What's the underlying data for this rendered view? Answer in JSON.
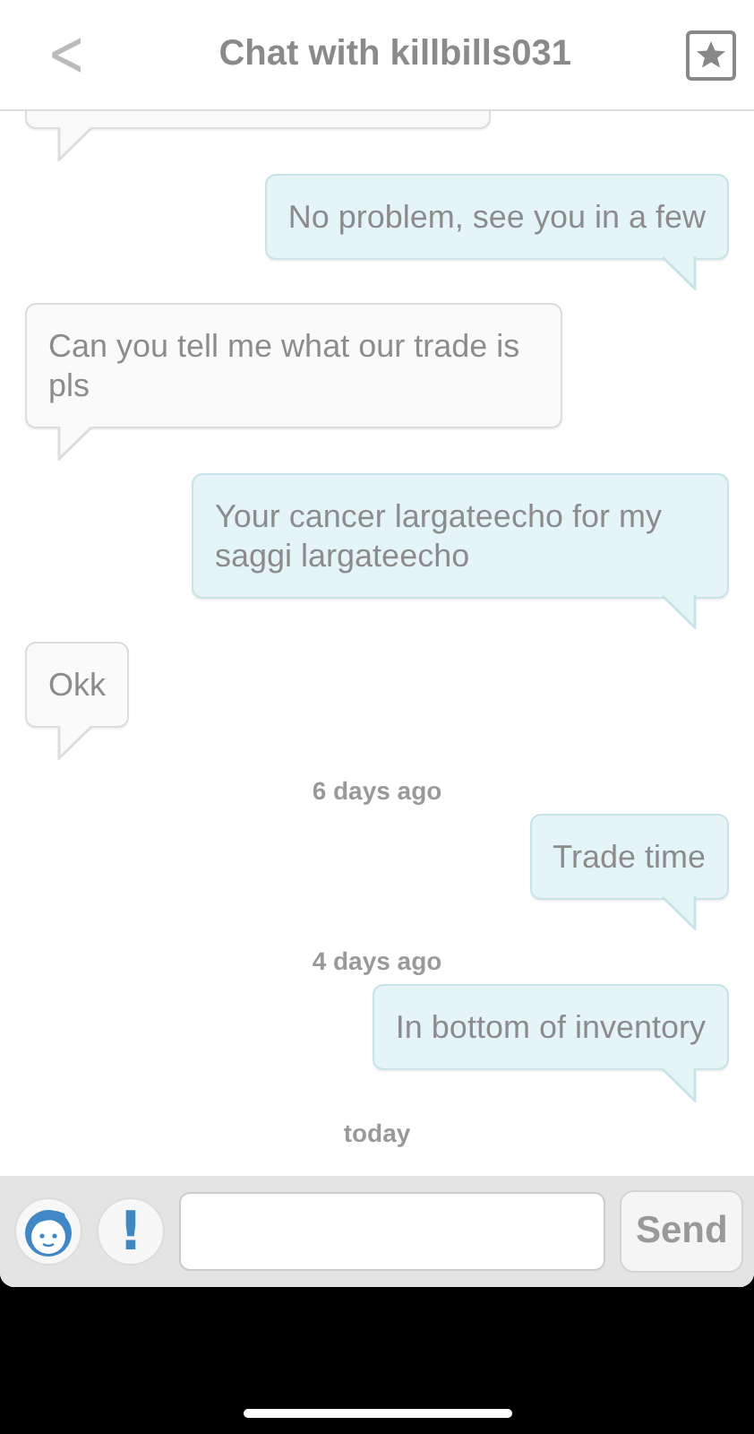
{
  "header": {
    "back_icon": "<",
    "title": "Chat with killbills031"
  },
  "messages": [
    {
      "kind": "outgoing",
      "text": "No problem, see you in a few"
    },
    {
      "kind": "incoming",
      "text": "Can you tell me what our trade is pls"
    },
    {
      "kind": "outgoing",
      "text": "Your cancer largateecho for my saggi largateecho"
    },
    {
      "kind": "incoming",
      "text": "Okk"
    },
    {
      "kind": "timestamp",
      "text": "6 days ago"
    },
    {
      "kind": "outgoing",
      "text": "Trade time"
    },
    {
      "kind": "timestamp",
      "text": "4 days ago"
    },
    {
      "kind": "outgoing",
      "text": "In bottom of inventory"
    },
    {
      "kind": "timestamp",
      "text": "today"
    }
  ],
  "composer": {
    "send_label": "Send",
    "alert_icon": "!"
  }
}
